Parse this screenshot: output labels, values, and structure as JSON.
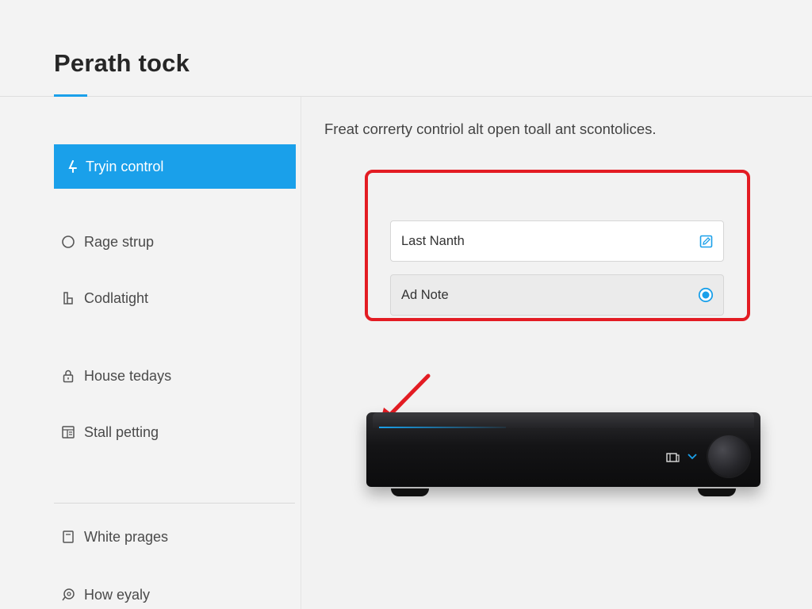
{
  "header": {
    "title": "Perath tock"
  },
  "sidebar": {
    "items": [
      {
        "label": "Tryin control",
        "icon": "plug-icon",
        "active": true
      },
      {
        "label": "Rage strup",
        "icon": "circle-icon"
      },
      {
        "label": "Codlatight",
        "icon": "device-icon"
      },
      {
        "label": "House tedays",
        "icon": "lock-icon"
      },
      {
        "label": "Stall petting",
        "icon": "panel-icon"
      },
      {
        "label": "White prages",
        "icon": "page-icon"
      },
      {
        "label": "How eyaly",
        "icon": "help-icon"
      }
    ]
  },
  "main": {
    "description": "Freat correrty contriol alt open toall ant scontolices.",
    "fields": [
      {
        "label": "Last Nanth",
        "icon": "edit-icon"
      },
      {
        "label": "Ad Note",
        "icon": "radio-selected-icon"
      }
    ]
  },
  "colors": {
    "accent": "#1aa0ea",
    "highlight": "#e31c23"
  }
}
